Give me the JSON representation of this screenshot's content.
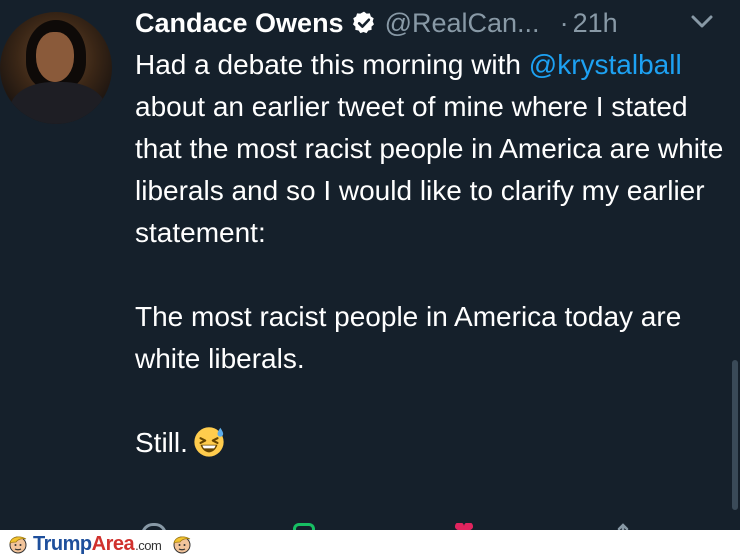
{
  "tweet": {
    "author_name": "Candace Owens",
    "handle": "@RealCan...",
    "separator": "·",
    "time": "21h",
    "text": {
      "line1": "Had a debate this morning with",
      "mention": "@krystalball",
      "after_mention": " about an earlier tweet of mine where I stated that the most racist people in America are white liberals and so I would like to clarify my earlier statement:",
      "para2": "The most racist people in America today are white liberals.",
      "para3": "Still."
    },
    "emoji_name": "grinning-squinting-face-with-sweat",
    "icons": [
      "verified-badge-icon",
      "chevron-down-icon",
      "reply-icon",
      "retweet-icon",
      "like-icon",
      "share-icon"
    ]
  },
  "watermark": {
    "brand_part1": "Trump",
    "brand_part2": "Area",
    "brand_part3": ".com"
  },
  "colors": {
    "background": "#15202b",
    "text": "#ffffff",
    "muted": "#8899a6",
    "mention": "#1da1f2",
    "like": "#e0245e",
    "retweet": "#17bf63"
  }
}
